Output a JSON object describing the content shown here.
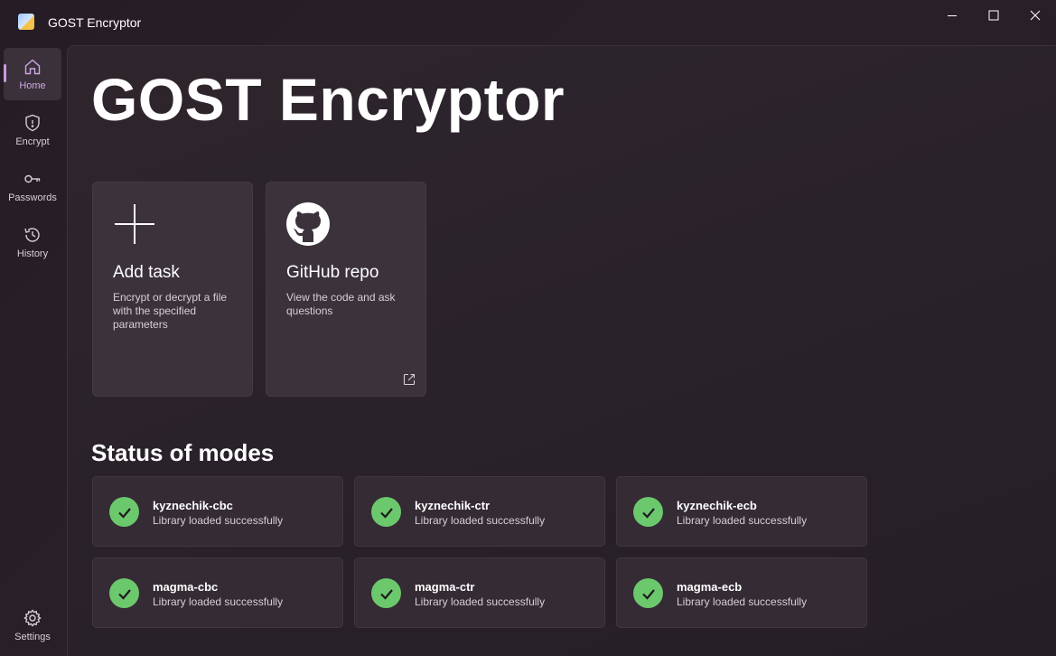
{
  "window": {
    "title": "GOST Encryptor"
  },
  "sidebar": {
    "items": [
      {
        "label": "Home",
        "icon": "home-icon",
        "active": true
      },
      {
        "label": "Encrypt",
        "icon": "shield-icon",
        "active": false
      },
      {
        "label": "Passwords",
        "icon": "key-icon",
        "active": false
      },
      {
        "label": "History",
        "icon": "history-icon",
        "active": false
      }
    ],
    "settings": {
      "label": "Settings",
      "icon": "gear-icon"
    }
  },
  "main": {
    "title": "GOST Encryptor",
    "tiles": [
      {
        "title": "Add task",
        "description": "Encrypt or decrypt a file with the specified parameters",
        "icon": "plus-icon"
      },
      {
        "title": "GitHub repo",
        "description": "View the code and ask questions",
        "icon": "github-icon",
        "link_icon": "external-link-icon"
      }
    ],
    "status_section_title": "Status of modes",
    "modes": [
      {
        "name": "kyznechik-cbc",
        "message": "Library loaded successfully",
        "status": "ok"
      },
      {
        "name": "kyznechik-ctr",
        "message": "Library loaded successfully",
        "status": "ok"
      },
      {
        "name": "kyznechik-ecb",
        "message": "Library loaded successfully",
        "status": "ok"
      },
      {
        "name": "magma-cbc",
        "message": "Library loaded successfully",
        "status": "ok"
      },
      {
        "name": "magma-ctr",
        "message": "Library loaded successfully",
        "status": "ok"
      },
      {
        "name": "magma-ecb",
        "message": "Library loaded successfully",
        "status": "ok"
      }
    ]
  },
  "colors": {
    "accent": "#cfa8e4",
    "success": "#6cc86c",
    "background": "#2a222a",
    "card": "#3b323b"
  }
}
